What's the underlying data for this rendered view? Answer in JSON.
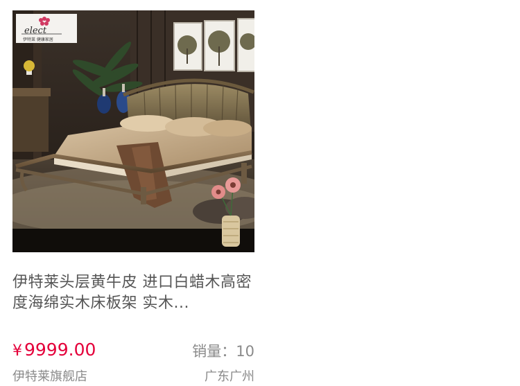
{
  "product": {
    "title": "伊特莱头层黄牛皮  进口白蜡木高密度海绵实木床板架  实木...",
    "currency_symbol": "¥",
    "price": "9999.00",
    "sales_label": "销量：",
    "sales_count": "10",
    "shop_name": "伊特莱旗舰店",
    "location": "广东广州",
    "image": {
      "logo_text": "elect",
      "logo_subtext": "伊特莱 健康家居"
    }
  },
  "colors": {
    "price": "#e4003a",
    "title": "#555555",
    "meta": "#8a8a8a"
  }
}
